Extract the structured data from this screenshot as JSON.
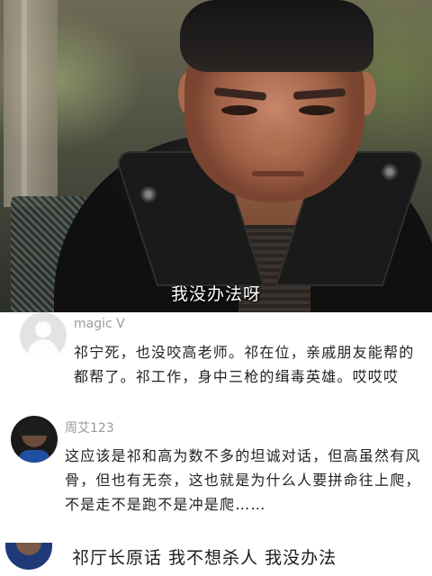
{
  "video": {
    "subtitle": "我没办法呀"
  },
  "comments": [
    {
      "username": "magic V",
      "avatar": "default-user-avatar",
      "text": "祁宁死，也没咬高老师。祁在位，亲戚朋友能帮的都帮了。祁工作，身中三枪的缉毒英雄。哎哎哎"
    },
    {
      "username": "周艾123",
      "avatar": "photo-avatar",
      "text": "这应该是祁和高为数不多的坦诚对话，但高虽然有风骨，但也有无奈，这也就是为什么人要拼命往上爬，不是走不是跑不是冲是爬……"
    },
    {
      "username": "",
      "avatar": "photo-avatar",
      "text": "祁厅长原话 我不想杀人 我没办法"
    }
  ]
}
